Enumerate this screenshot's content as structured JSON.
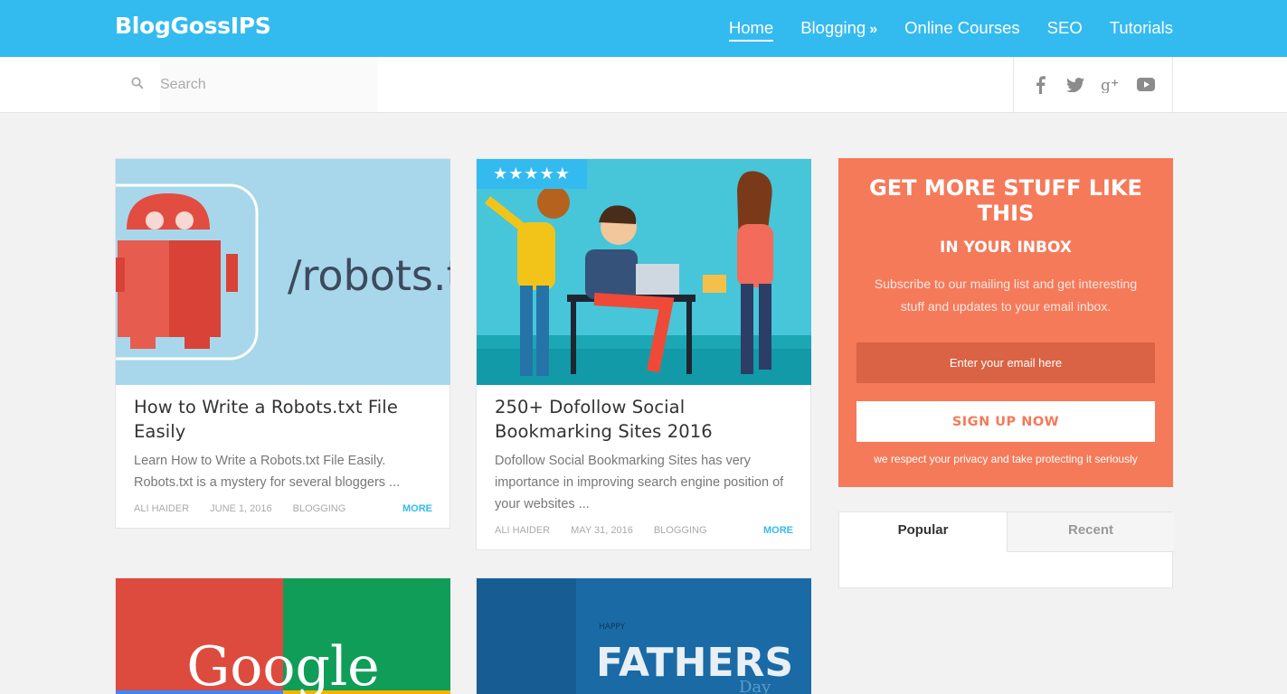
{
  "site": {
    "logo": "BlogGossIPS"
  },
  "nav": {
    "items": [
      {
        "label": "Home",
        "active": true
      },
      {
        "label": "Blogging",
        "has_submenu": true,
        "submenu_icon": "»"
      },
      {
        "label": "Online Courses"
      },
      {
        "label": "SEO"
      },
      {
        "label": "Tutorials"
      }
    ]
  },
  "search": {
    "placeholder": "Search",
    "icon": "search-icon"
  },
  "social": {
    "icons": [
      "facebook-icon",
      "twitter-icon",
      "google-plus-icon",
      "youtube-icon"
    ]
  },
  "posts": [
    {
      "image_text": "/robots.tx",
      "title": "How to Write a Robots.txt File Easily",
      "excerpt": "Learn How to Write a Robots.txt File Easily. Robots.txt is a mystery for several bloggers ...",
      "author": "ALI HAIDER",
      "date": "JUNE 1, 2016",
      "category": "BLOGGING",
      "more": "MORE"
    },
    {
      "rating": "★★★★★",
      "title": "250+ Dofollow Social Bookmarking Sites 2016",
      "excerpt": "Dofollow Social Bookmarking Sites has very importance in improving search engine position of your websites ...",
      "author": "ALI HAIDER",
      "date": "MAY 31, 2016",
      "category": "BLOGGING",
      "more": "MORE"
    },
    {
      "image_text": "Google"
    },
    {
      "image_text": "FATHERS",
      "image_subtext": "HAPPY",
      "image_day": "Day"
    }
  ],
  "newsletter": {
    "title": "GET MORE STUFF LIKE THIS",
    "subtitle": "IN YOUR INBOX",
    "text": "Subscribe to our mailing list and get interesting stuff and updates to your email inbox.",
    "email_placeholder": "Enter your email here",
    "button": "SIGN UP NOW",
    "privacy": "we respect your privacy and take protecting it seriously"
  },
  "tabs": {
    "items": [
      "Popular",
      "Recent"
    ],
    "active": "Popular"
  },
  "colors": {
    "brand": "#33bbf0",
    "accent": "#f47a5a"
  }
}
